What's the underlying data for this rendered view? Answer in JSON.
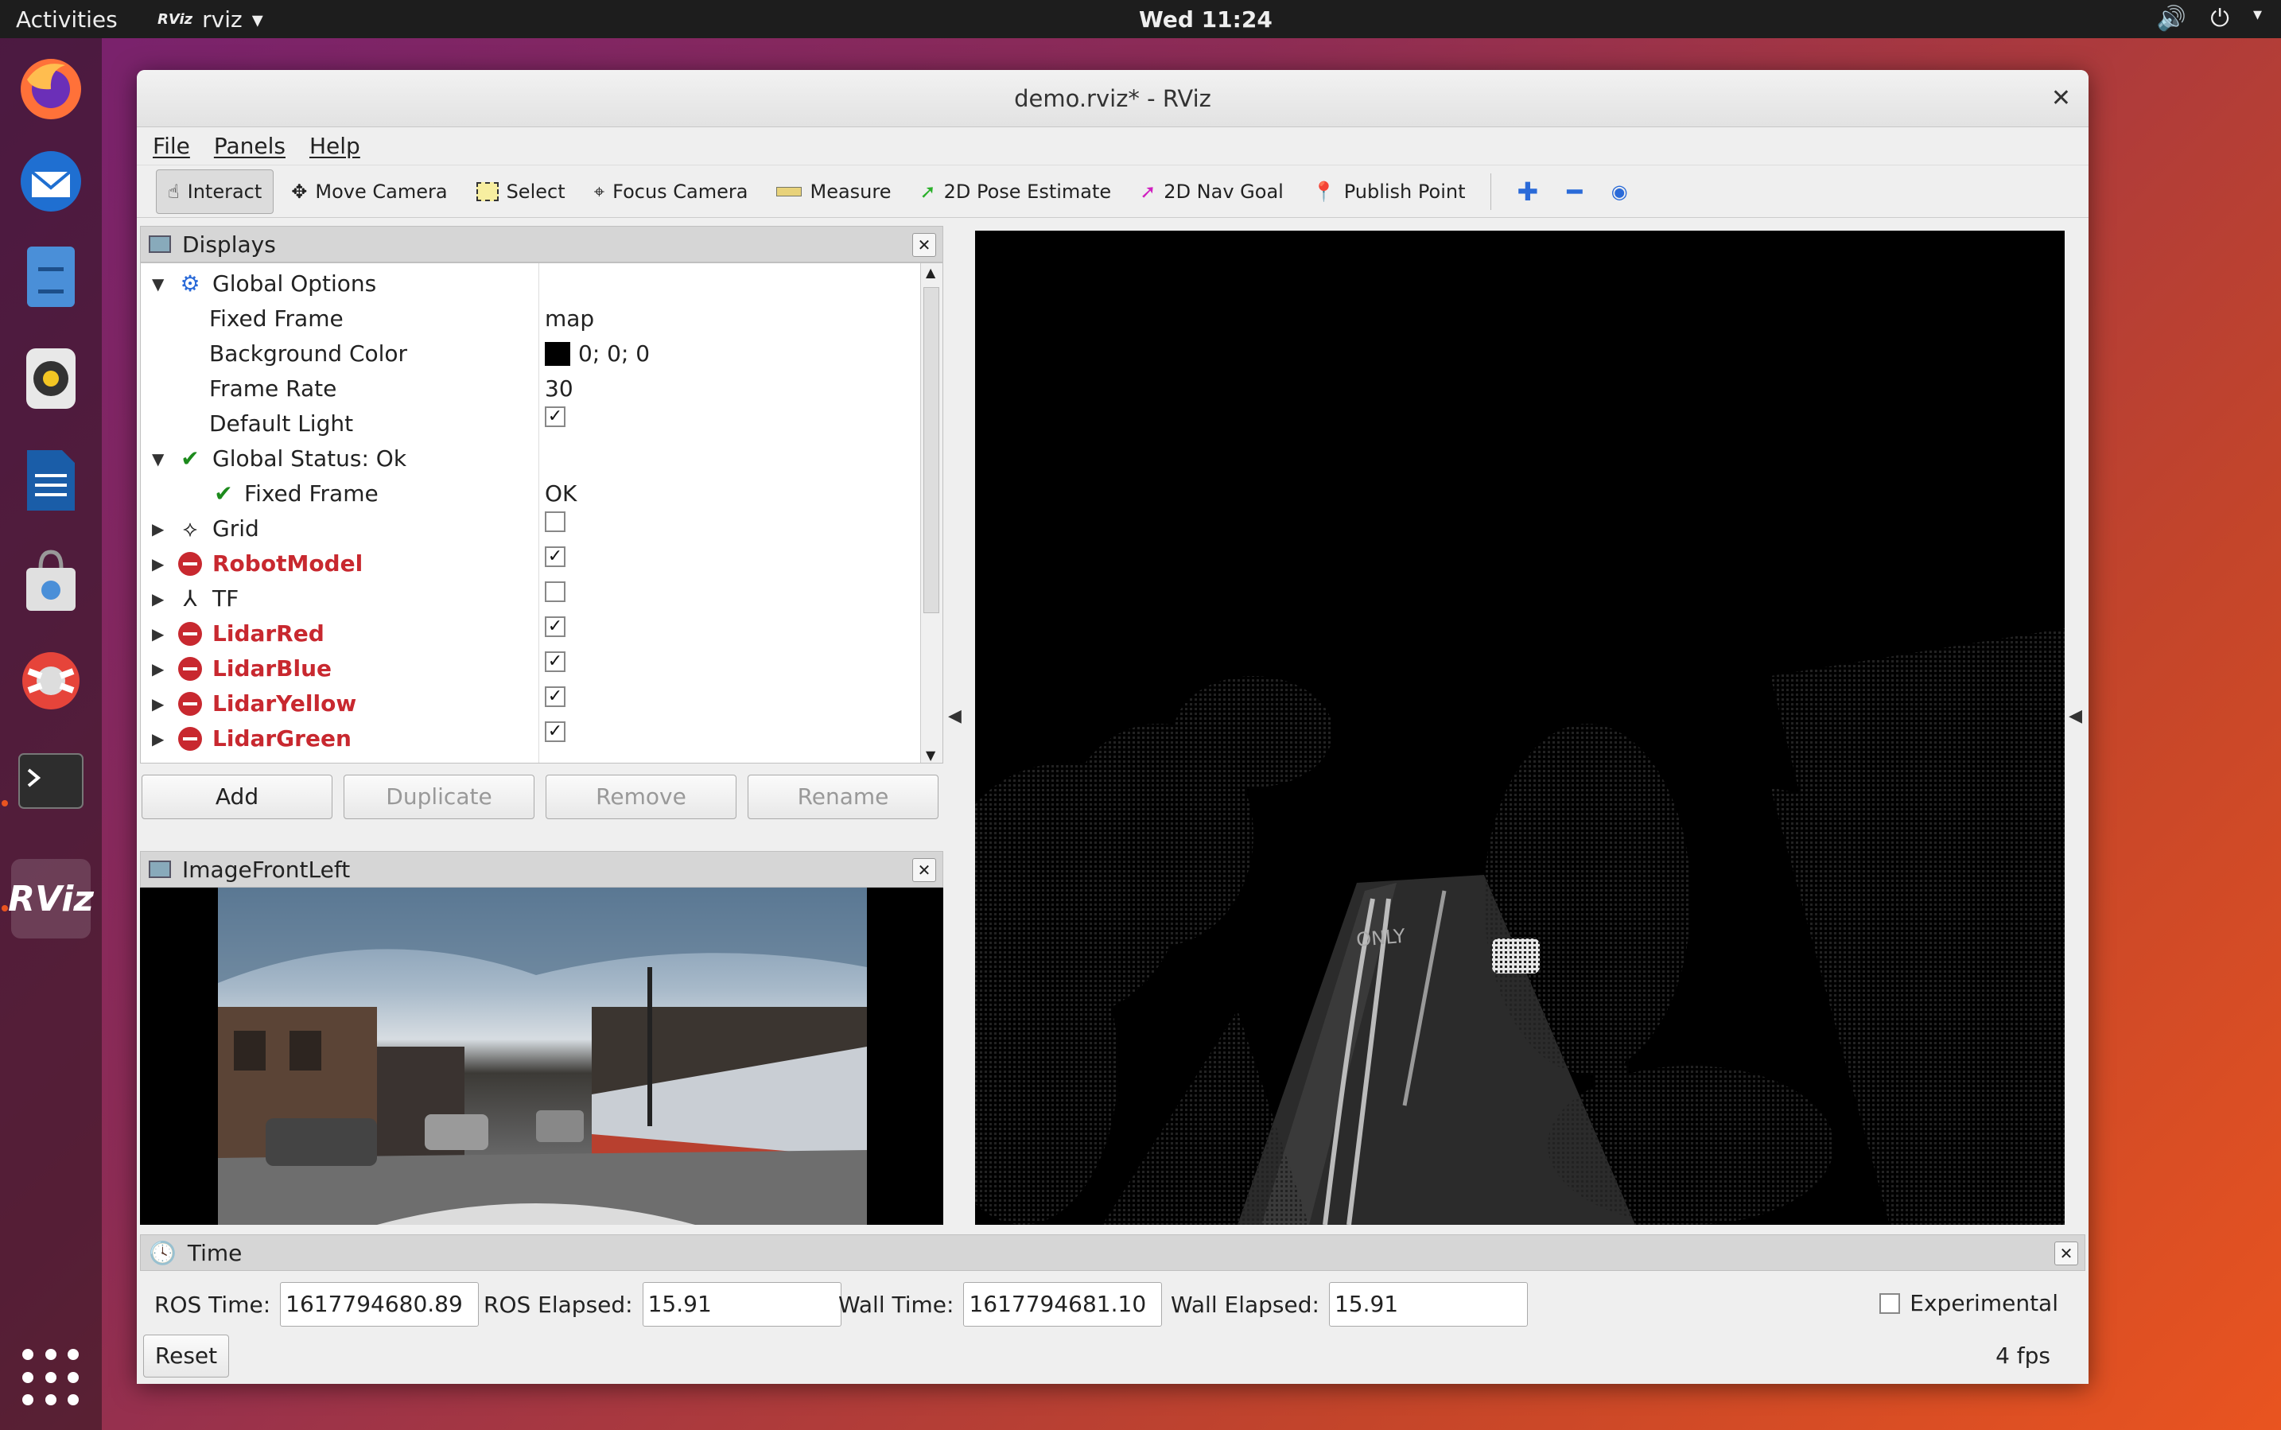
{
  "topbar": {
    "activities": "Activities",
    "app_name": "rviz",
    "app_badge": "RViz",
    "clock": "Wed 11:24"
  },
  "window": {
    "title": "demo.rviz* - RViz",
    "menus": [
      "File",
      "Panels",
      "Help"
    ]
  },
  "toolbar": {
    "interact": "Interact",
    "move_camera": "Move Camera",
    "select": "Select",
    "focus_camera": "Focus Camera",
    "measure": "Measure",
    "pose_estimate": "2D Pose Estimate",
    "nav_goal": "2D Nav Goal",
    "publish_point": "Publish Point"
  },
  "displays": {
    "title": "Displays",
    "global_options": "Global Options",
    "fixed_frame_label": "Fixed Frame",
    "fixed_frame_value": "map",
    "background_color_label": "Background Color",
    "background_color_value": "0; 0; 0",
    "background_color_hex": "#000000",
    "frame_rate_label": "Frame Rate",
    "frame_rate_value": "30",
    "default_light_label": "Default Light",
    "global_status": "Global Status: Ok",
    "status_fixed_frame": "Fixed Frame",
    "status_fixed_frame_value": "OK",
    "grid": "Grid",
    "robot_model": "RobotModel",
    "tf": "TF",
    "lidar_red": "LidarRed",
    "lidar_blue": "LidarBlue",
    "lidar_yellow": "LidarYellow",
    "lidar_green": "LidarGreen",
    "buttons": {
      "add": "Add",
      "duplicate": "Duplicate",
      "remove": "Remove",
      "rename": "Rename"
    }
  },
  "image_panel": {
    "title": "ImageFrontLeft"
  },
  "time_panel": {
    "title": "Time",
    "ros_time_label": "ROS Time:",
    "ros_time_value": "1617794680.89",
    "ros_elapsed_label": "ROS Elapsed:",
    "ros_elapsed_value": "15.91",
    "wall_time_label": "Wall Time:",
    "wall_time_value": "1617794681.10",
    "wall_elapsed_label": "Wall Elapsed:",
    "wall_elapsed_value": "15.91",
    "experimental": "Experimental",
    "reset": "Reset",
    "fps": "4 fps"
  },
  "colors": {
    "error": "#c8282f",
    "ok": "#1c8a1c",
    "ubuntu_orange": "#e95420"
  }
}
